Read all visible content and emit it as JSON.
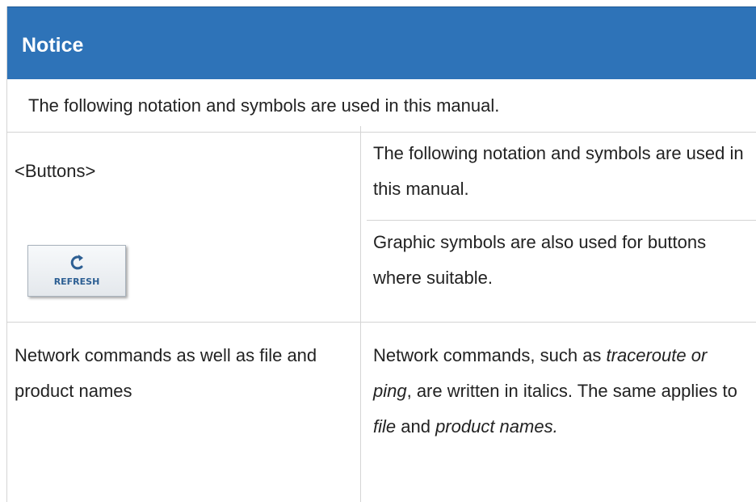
{
  "notice": {
    "title": "Notice",
    "intro": "The following notation and symbols are used in this manual."
  },
  "rows": {
    "buttons": {
      "label": "<Buttons>",
      "description": "The following notation and symbols are used in this manual."
    },
    "graphic": {
      "button_label": "REFRESH",
      "icon": "refresh-icon",
      "description": "Graphic symbols are also used for buttons where suitable."
    },
    "commands": {
      "label": "Network commands as well as file and product names",
      "description_part1": "Network commands, such as ",
      "description_italic1": "traceroute or ping",
      "description_part2": ", are written in italics. The same applies to ",
      "description_italic2": "file",
      "description_part3": " and ",
      "description_italic3": "product names."
    }
  },
  "colors": {
    "header_background": "#2e73b8",
    "border": "#d4d4d4",
    "button_text": "#2d5f93"
  }
}
